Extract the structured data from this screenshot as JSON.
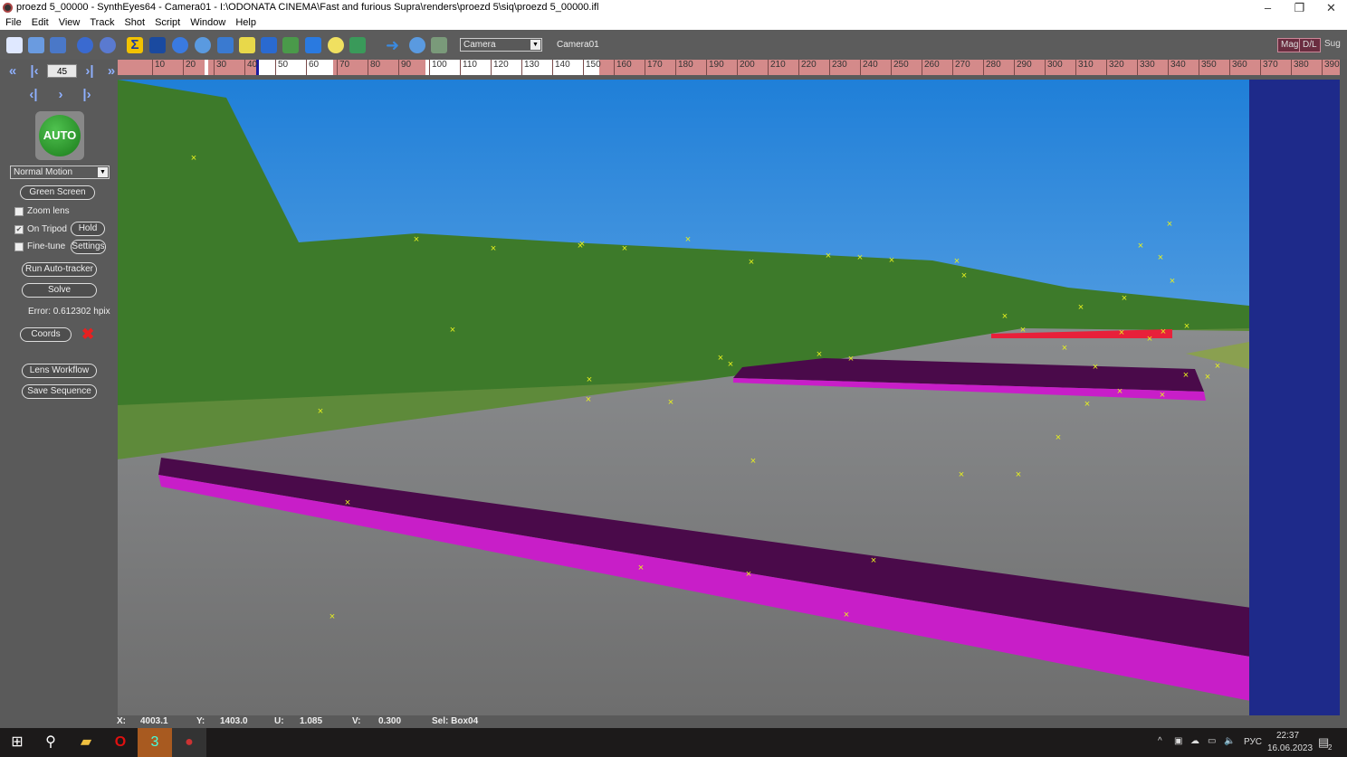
{
  "window": {
    "title": "proezd 5_00000 - SynthEyes64 - Camera01 - I:\\ODONATA CINEMA\\Fast and furious Supra\\renders\\proezd 5\\siq\\proezd 5_00000.ifl",
    "minimize": "–",
    "restore": "❐",
    "close": "✕"
  },
  "menu": [
    "File",
    "Edit",
    "View",
    "Track",
    "Shot",
    "Script",
    "Window",
    "Help"
  ],
  "toolbar": {
    "view_select": "Camera",
    "camera_label": "Camera01",
    "mag": "Mag",
    "dl": "D/L",
    "sug": "Sug"
  },
  "timeline": {
    "current_frame": "45",
    "ticks": [
      "10",
      "20",
      "30",
      "40",
      "50",
      "60",
      "70",
      "80",
      "90",
      "100",
      "110",
      "120",
      "130",
      "140",
      "150",
      "160",
      "170",
      "180",
      "190",
      "200",
      "210",
      "220",
      "230",
      "240",
      "250",
      "260",
      "270",
      "280",
      "290",
      "300",
      "310",
      "320",
      "330",
      "340",
      "350",
      "360",
      "370",
      "380",
      "390"
    ]
  },
  "left_panel": {
    "auto": "AUTO",
    "motion": "Normal Motion",
    "green_screen": "Green Screen",
    "zoom_lens": "Zoom lens",
    "zoom_lens_checked": false,
    "on_tripod": "On Tripod",
    "on_tripod_checked": true,
    "hold": "Hold",
    "fine_tune": "Fine-tune",
    "fine_tune_checked": false,
    "settings": "Settings",
    "run_autotracker": "Run Auto-tracker",
    "solve": "Solve",
    "error": "Error: 0.612302 hpix",
    "coords": "Coords",
    "lens_workflow": "Lens Workflow",
    "save_sequence": "Save Sequence"
  },
  "status": {
    "x_label": "X:",
    "x": "4003.1",
    "y_label": "Y:",
    "y": "1403.0",
    "u_label": "U:",
    "u": "1.085",
    "v_label": "V:",
    "v": "0.300",
    "sel": "Sel: Box04"
  },
  "taskbar": {
    "lang": "РУС",
    "time": "22:37",
    "date": "16.06.2023",
    "notifications": "2"
  },
  "colors": {
    "box": "#c81ec8",
    "box_top": "#5a0a5a",
    "tracker": "#e6f01e",
    "timeline_pink": "#d48a8a",
    "viewport_bg": "#1e2a8a"
  }
}
